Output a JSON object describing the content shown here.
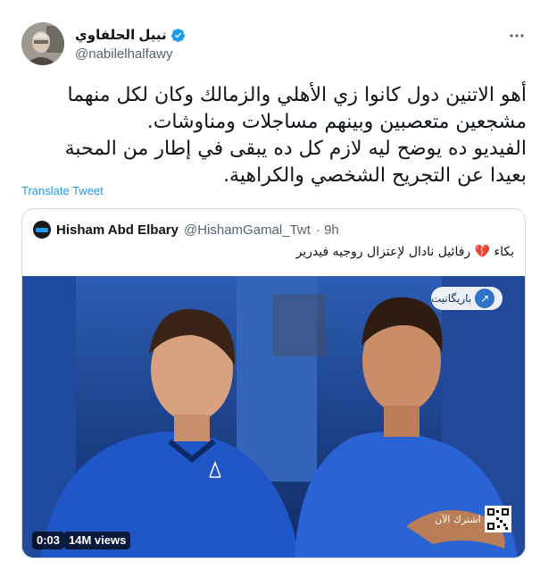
{
  "tweet": {
    "display_name": "نبيل الحلفاوي",
    "handle": "@nabilelhalfawy",
    "text_lines": [
      "أهو الاتنين دول كانوا زي الأهلي والزمالك وكان لكل منهما",
      "مشجعين متعصبين وبينهم مساجلات ومناوشات.",
      "الفيديو ده يوضح ليه لازم كل ده يبقى في إطار من المحبة",
      "بعيدا عن التجريح الشخصي والكراهية."
    ],
    "translate_label": "Translate Tweet"
  },
  "quote": {
    "name": "Hisham Abd Elbary",
    "handle": "@HishamGamal_Twt",
    "time": "· 9h",
    "text_prefix": "بكاء",
    "text_suffix": "رفائيل نادال لإعتزال روجيه فيدرير",
    "video": {
      "logo_text": "باريگانيت",
      "subscribe_text": "اشترك الآن",
      "duration": "0:03",
      "views": "14M views"
    }
  },
  "colors": {
    "accent": "#1d9bf0",
    "verified": "#1d9bf0",
    "text": "#0f1419",
    "muted": "#536471",
    "border": "#cfd9de",
    "broken_heart": "#d8324a"
  },
  "icons": [
    "verified-badge-icon",
    "more-options-icon",
    "broken-heart-icon",
    "qr-code-icon"
  ]
}
